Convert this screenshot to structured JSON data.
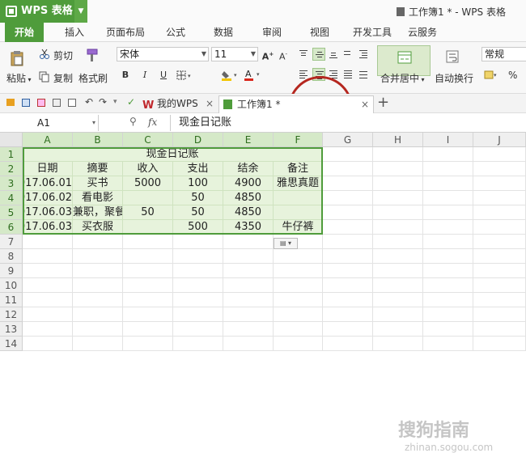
{
  "app": {
    "name": "WPS 表格",
    "window_title": "工作簿1 * - WPS 表格"
  },
  "ribbon_tabs": [
    "开始",
    "插入",
    "页面布局",
    "公式",
    "数据",
    "审阅",
    "视图",
    "开发工具",
    "云服务"
  ],
  "ribbon": {
    "cut": "剪切",
    "copy": "复制",
    "paste": "粘贴",
    "format_painter": "格式刷",
    "font_name": "宋体",
    "font_size": "11",
    "bold": "B",
    "italic": "I",
    "underline": "U",
    "merge_center": "合并居中",
    "wrap_text": "自动换行",
    "number_format": "常规",
    "percent": "%"
  },
  "doc_tabs": {
    "home": "我的WPS",
    "workbook": "工作簿1 *"
  },
  "formula_bar": {
    "cell_ref": "A1",
    "fx": "fx",
    "content": "现金日记账"
  },
  "grid": {
    "columns": [
      "A",
      "B",
      "C",
      "D",
      "E",
      "F",
      "G",
      "H",
      "I",
      "J"
    ],
    "rows": [
      "1",
      "2",
      "3",
      "4",
      "5",
      "6",
      "7",
      "8",
      "9",
      "10",
      "11",
      "12",
      "13",
      "14"
    ],
    "title": "现金日记账",
    "headers": [
      "日期",
      "摘要",
      "收入",
      "支出",
      "结余",
      "备注"
    ],
    "data": [
      [
        "2017.06.01",
        "买书",
        "5000",
        "100",
        "4900",
        "雅思真题"
      ],
      [
        "2017.06.02",
        "看电影",
        "",
        "50",
        "4850",
        ""
      ],
      [
        "2017.06.03",
        "兼职，聚餐",
        "50",
        "50",
        "4850",
        ""
      ],
      [
        "2017.06.03",
        "买衣服",
        "",
        "500",
        "4350",
        "牛仔裤"
      ]
    ]
  },
  "watermark": {
    "text": "搜狗指南",
    "url": "zhinan.sogou.com"
  }
}
